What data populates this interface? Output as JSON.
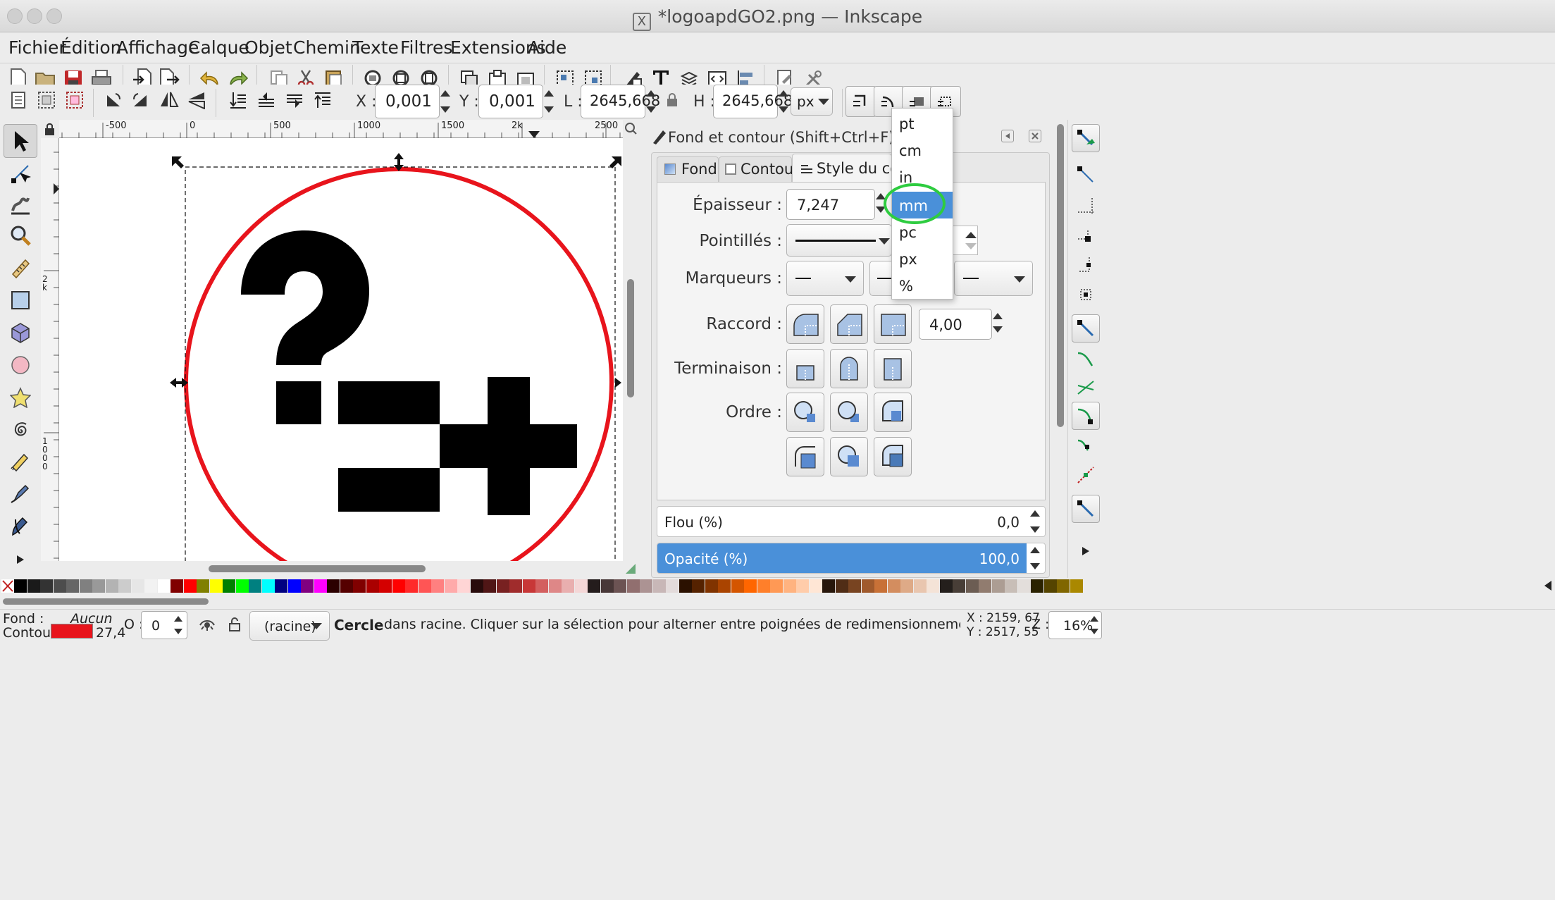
{
  "window": {
    "title": "*logoapdGO2.png — Inkscape"
  },
  "menu": [
    "Fichier",
    "Édition",
    "Affichage",
    "Calque",
    "Objet",
    "Chemin",
    "Texte",
    "Filtres",
    "Extensions",
    "Aide"
  ],
  "toolbar": {
    "x_label": "X :",
    "x_value": "0,001",
    "y_label": "Y :",
    "y_value": "0,001",
    "w_label": "L :",
    "w_value": "2645,668",
    "h_label": "H :",
    "h_value": "2645,668",
    "unit": "px"
  },
  "ruler": {
    "h_ticks": [
      "-500",
      "0",
      "500",
      "1000",
      "1500",
      "2k",
      "2500"
    ],
    "v_ticks": [
      "2k",
      "1000"
    ]
  },
  "unit_menu": {
    "options": [
      "pt",
      "cm",
      "in",
      "mm",
      "pc",
      "px",
      "%"
    ],
    "selected": "mm"
  },
  "dialog": {
    "title": "Fond et contour (Shift+Ctrl+F)",
    "tabs": [
      "Fond",
      "Contour",
      "Style du cont"
    ],
    "epaisseur_label": "Épaisseur :",
    "epaisseur_value": "7,247",
    "pointilles_label": "Pointillés :",
    "marqueurs_label": "Marqueurs :",
    "raccord_label": "Raccord :",
    "raccord_value": "4,00",
    "terminaison_label": "Terminaison :",
    "ordre_label": "Ordre :",
    "flou_label": "Flou (%)",
    "flou_value": "0,0",
    "opacite_label": "Opacité (%)",
    "opacite_value": "100,0"
  },
  "status": {
    "fond_label": "Fond :",
    "fond_value": "Aucun",
    "contour_label": "Contour :",
    "contour_width": "27,4",
    "o_label": "O :",
    "o_value": "0",
    "layer": "(racine)",
    "message_strong": "Cercle",
    "message": "dans racine. Cliquer sur la sélection pour alterner entre poignées de redimensionnement et de r...",
    "x_coord": "X : 2159, 67",
    "y_coord": "Y : 2517, 55",
    "zoom_label": "Z :",
    "zoom": "16%"
  },
  "colors": {
    "accent": "#4a90d9",
    "stroke": "#e8141c",
    "highlight_circle": "#2ecc40"
  }
}
